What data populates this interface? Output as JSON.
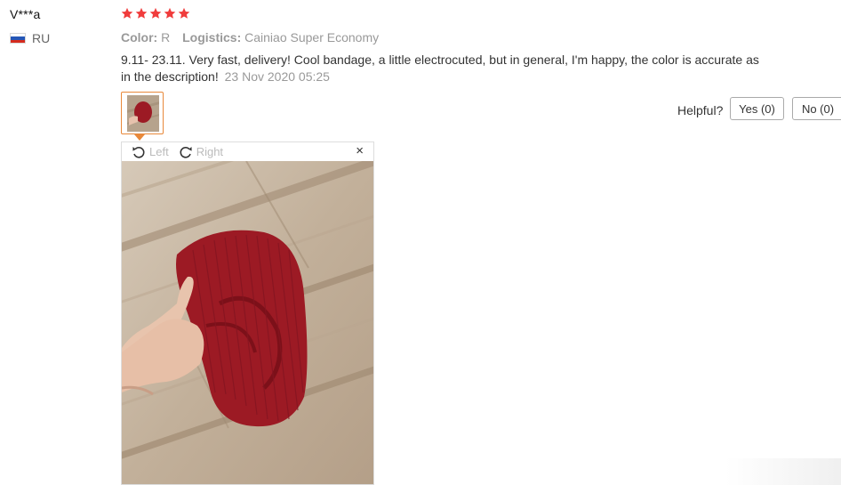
{
  "review": {
    "username": "V***a",
    "country_code": "RU",
    "rating": 5,
    "star_color": "#f03c3c",
    "color_label": "Color:",
    "color_value": "R",
    "logistics_label": "Logistics:",
    "logistics_value": "Cainiao Super Economy",
    "text": "9.11- 23.11. Very fast, delivery! Cool bandage, a little electrocuted, but in general, I'm happy, the color is accurate as in the description!",
    "date": "23 Nov 2020 05:25"
  },
  "helpful": {
    "label": "Helpful?",
    "yes_label": "Yes (0)",
    "no_label": "No (0)"
  },
  "viewer": {
    "rotate_left_label": "Left",
    "rotate_right_label": "Right",
    "close_label": "×",
    "accent": "#e8883a"
  },
  "photo": {
    "subject_color": "#9c1a24",
    "floor_color": "#c9b9a5"
  }
}
